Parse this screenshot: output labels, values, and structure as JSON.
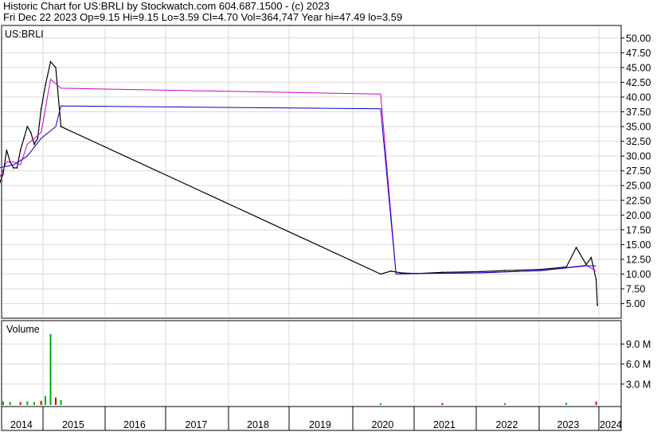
{
  "header": {
    "line1": "Historic Chart for US:BRLI by Stockwatch.com 604.687.1500 - (c) 2023",
    "line2": "Fri Dec 22 2023   Op=9.15  Hi=9.15  Lo=3.59  Cl=4.70  Vol=364,747  Year hi=47.49  lo=3.59"
  },
  "chart_data": [
    {
      "type": "line",
      "title": "US:BRLI",
      "ylim": [
        2.5,
        52.5
      ],
      "y_ticks": [
        "50.00",
        "47.50",
        "45.00",
        "42.50",
        "40.00",
        "37.50",
        "35.00",
        "32.50",
        "30.00",
        "27.50",
        "25.00",
        "22.50",
        "20.00",
        "17.50",
        "15.00",
        "12.50",
        "10.00",
        "7.50",
        "5.00"
      ],
      "x_labels": [
        "2014",
        "2015",
        "2016",
        "2017",
        "2018",
        "2019",
        "2020",
        "2021",
        "2022",
        "2023",
        "2024"
      ],
      "grid": true,
      "colors": {
        "price": "#000000",
        "ma_short": "#cc00cc",
        "ma_long": "#0000cc",
        "ma_red": "#dd0000"
      },
      "series": [
        {
          "name": "price",
          "x": [
            "2013-12",
            "2014-01",
            "2014-02",
            "2014-03",
            "2014-04",
            "2014-05",
            "2014-06",
            "2014-07",
            "2014-08",
            "2014-09",
            "2014-10",
            "2014-11",
            "2014-12",
            "2015-01",
            "2015-02",
            "2015-03",
            "2015-04",
            "2020-06",
            "2020-08",
            "2020-10",
            "2021-01",
            "2021-06",
            "2022-01",
            "2022-06",
            "2023-01",
            "2023-06",
            "2023-08",
            "2023-10",
            "2023-11",
            "2023-12",
            "2023-12-22"
          ],
          "values": [
            25,
            27,
            31,
            29,
            28,
            28,
            31,
            33,
            35,
            34,
            32,
            33,
            38,
            42,
            46,
            45,
            35,
            10,
            10.5,
            10.2,
            10.1,
            10.3,
            10.4,
            10.6,
            10.8,
            11.2,
            14.5,
            11.6,
            12.8,
            9,
            4.7
          ]
        },
        {
          "name": "ma-short",
          "x": [
            "2013-12",
            "2014-02",
            "2014-04",
            "2014-06",
            "2014-08",
            "2014-10",
            "2014-12",
            "2015-02",
            "2015-04",
            "2020-06",
            "2020-09",
            "2021-01",
            "2022-01",
            "2023-01",
            "2023-10",
            "2023-12"
          ],
          "values": [
            26,
            29,
            29,
            28.5,
            32,
            33,
            34,
            43,
            41.5,
            40.5,
            10,
            10.1,
            10.2,
            10.6,
            11.5,
            10.5
          ]
        },
        {
          "name": "ma-long",
          "x": [
            "2013-12",
            "2014-04",
            "2014-08",
            "2014-12",
            "2015-03",
            "2015-04",
            "2020-06",
            "2020-09",
            "2021-01",
            "2022-01",
            "2023-01",
            "2023-10",
            "2023-12"
          ],
          "values": [
            28,
            28.5,
            30,
            33,
            35,
            38.5,
            38,
            10,
            10.1,
            10.2,
            10.6,
            11.4,
            11.4
          ]
        }
      ]
    },
    {
      "type": "bar",
      "title": "Volume",
      "ylim": [
        0,
        12.5
      ],
      "y_ticks": [
        "9.0 M",
        "6.0 M",
        "3.0 M"
      ],
      "series": [
        {
          "name": "volume",
          "x": [
            "2013-12",
            "2014-01",
            "2014-03",
            "2014-06",
            "2014-08",
            "2014-10",
            "2014-12",
            "2015-01",
            "2015-02",
            "2015-03",
            "2015-04",
            "2020-06",
            "2021-06",
            "2022-06",
            "2023-06",
            "2023-12"
          ],
          "values": [
            1.5,
            0.4,
            0.3,
            0.3,
            0.4,
            0.3,
            0.5,
            1.2,
            10.5,
            1.0,
            0.6,
            0.1,
            0.15,
            0.15,
            0.2,
            0.4
          ]
        }
      ]
    }
  ]
}
